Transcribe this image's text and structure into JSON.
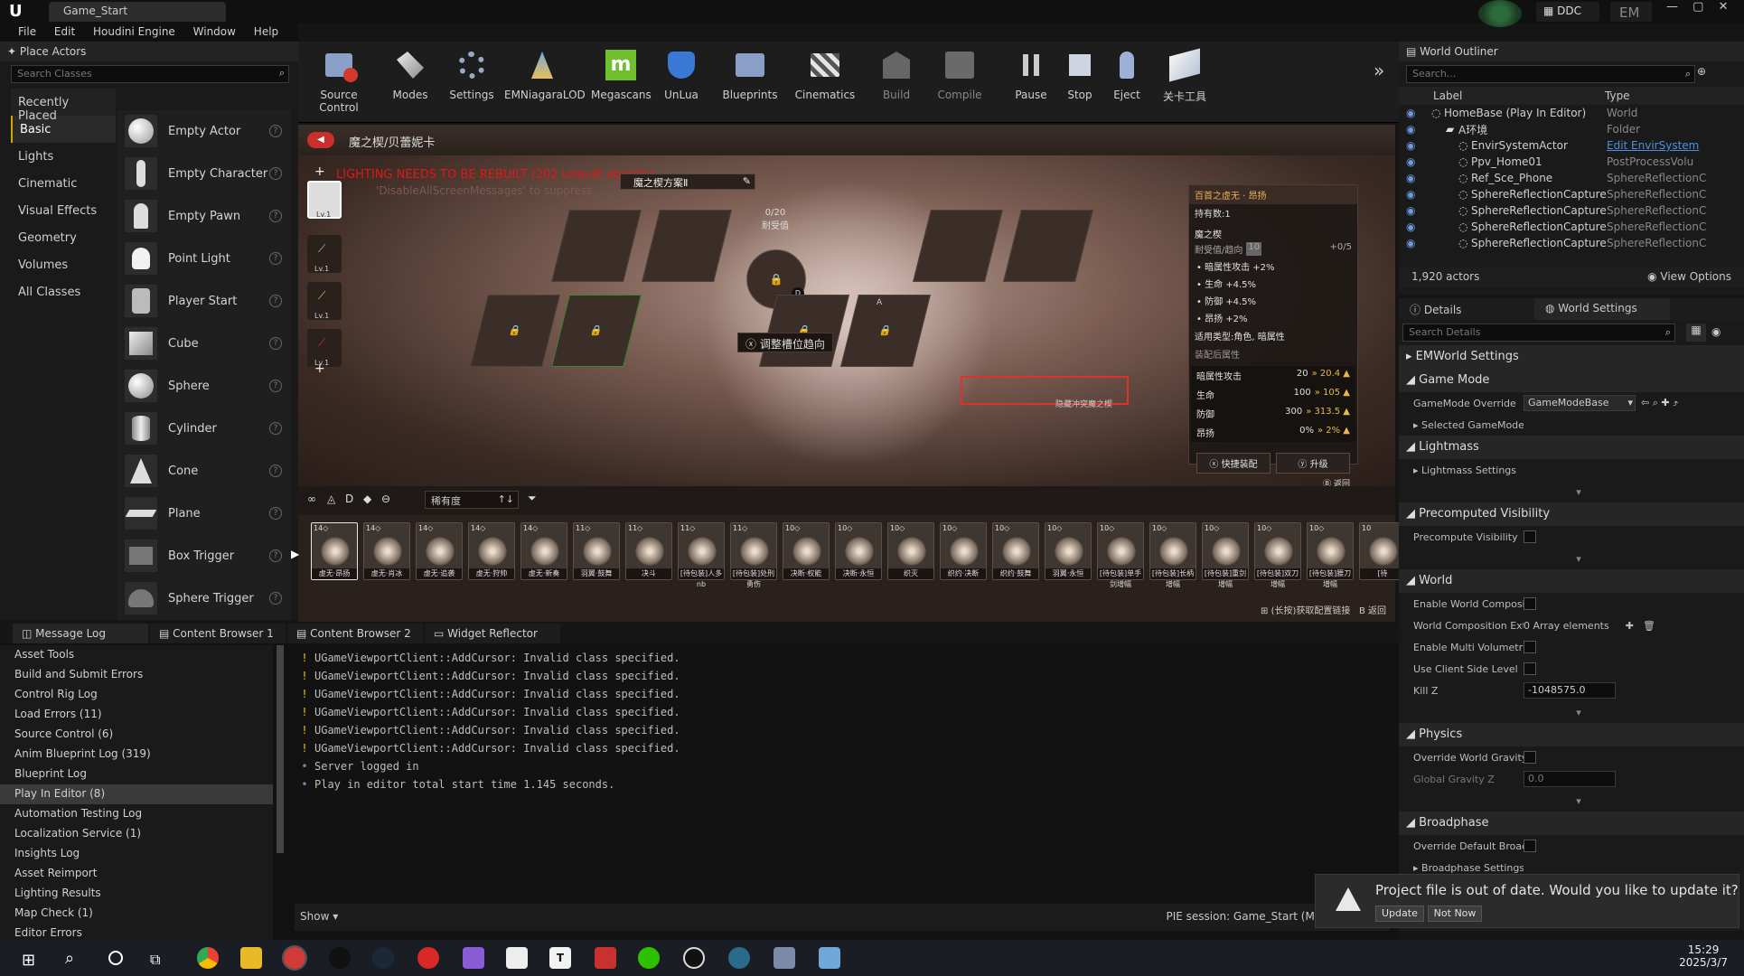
{
  "app": {
    "tab_title": "Game_Start",
    "menu": [
      "File",
      "Edit",
      "Houdini Engine",
      "Window",
      "Help"
    ],
    "ddc_label": "DDC",
    "user_initials": "EM"
  },
  "place_actors": {
    "title": "Place Actors",
    "search_placeholder": "Search Classes",
    "categories": [
      "Recently Placed",
      "Basic",
      "Lights",
      "Cinematic",
      "Visual Effects",
      "Geometry",
      "Volumes",
      "All Classes"
    ],
    "active_category": "Basic",
    "actors": [
      "Empty Actor",
      "Empty Character",
      "Empty Pawn",
      "Point Light",
      "Player Start",
      "Cube",
      "Sphere",
      "Cylinder",
      "Cone",
      "Plane",
      "Box Trigger",
      "Sphere Trigger"
    ]
  },
  "toolbar": {
    "tools": [
      "Source Control",
      "Modes",
      "Settings",
      "EMNiagaraLOD",
      "Megascans",
      "UnLua",
      "Blueprints",
      "Cinematics",
      "Build",
      "Compile",
      "Pause",
      "Stop",
      "Eject",
      "关卡工具"
    ]
  },
  "viewport": {
    "header_title": "魔之楔/贝蕾妮卡",
    "lighting_warning": "LIGHTING NEEDS TO BE REBUILT (202 unbuilt objects)",
    "suppress_hint": "'DisableAllScreenMessages' to suppress",
    "plan_label": "魔之楔方案Ⅱ",
    "gauge_value": "0/20",
    "gauge_label": "耐受值",
    "adjust_label": "调整槽位趋向",
    "center_badge": "D",
    "slot_badge": "A",
    "side_icon_level": "Lv.1",
    "stat_panel": {
      "title": "百首之虚无 · 昂扬",
      "owned": "持有数:1",
      "section": "魔之楔",
      "tolerance_label": "耐受值/趋向",
      "tolerance_badge": "10",
      "tolerance_value": "+0/5",
      "effects": [
        "暗属性攻击 +2%",
        "生命 +4.5%",
        "防御 +4.5%",
        "昂扬 +2%"
      ],
      "applicable": "适用类型:角色, 暗属性",
      "after_label": "装配后属性",
      "stats": [
        {
          "name": "暗属性攻击",
          "from": "20",
          "to": "20.4"
        },
        {
          "name": "生命",
          "from": "100",
          "to": "105"
        },
        {
          "name": "防御",
          "from": "300",
          "to": "313.5"
        },
        {
          "name": "昂扬",
          "from": "0%",
          "to": "2%"
        }
      ],
      "btn_quick": "快捷装配",
      "btn_quick_key": "X",
      "btn_upgrade": "升级",
      "btn_upgrade_key": "Y",
      "back_label": "返回",
      "back_key": "B",
      "hide_conflict": "隐藏冲突魔之楔"
    },
    "filter_label": "稀有度",
    "filter_badge": "↑↓",
    "filter_icons": [
      "∞",
      "◬",
      "D",
      "◆",
      "⊖"
    ],
    "cards": [
      "虚无·昂扬",
      "虚无·肖冰",
      "虚无·追袭",
      "虚无·狩帅",
      "虚无·新奏",
      "羽翼·鼓舞",
      "决斗",
      "[待包装]人多nb",
      "[待包装]处刑勇伤",
      "决断·权能",
      "决断·永恒",
      "织灭",
      "织约·决断",
      "织约·鼓舞",
      "羽翼·永恒",
      "[待包装]单手剑增幅",
      "[待包装]长柄增幅",
      "[待包装]重剑增幅",
      "[待包装]双刀增幅",
      "[待包装]腰刀增幅",
      "[待"
    ],
    "card_levels": [
      "14◇",
      "14◇",
      "14◇",
      "14◇",
      "14◇",
      "11◇",
      "11◇",
      "11◇",
      "11◇",
      "10◇",
      "10◇",
      "10◇",
      "10◇",
      "10◇",
      "10◇",
      "10◇",
      "10◇",
      "10◇",
      "10◇",
      "10◇",
      "10"
    ],
    "bottom_hint": "(长按)获取配置链接",
    "bottom_hint_key": "⊞",
    "bottom_back": "返回",
    "bottom_back_key": "B"
  },
  "outliner": {
    "title": "World Outliner",
    "search_placeholder": "Search...",
    "col_label": "Label",
    "col_type": "Type",
    "rows": [
      {
        "label": "HomeBase (Play In Editor)",
        "type": "World"
      },
      {
        "label": "A环境",
        "type": "Folder"
      },
      {
        "label": "EnvirSystemActor",
        "type": "Edit EnvirSystem"
      },
      {
        "label": "Ppv_Home01",
        "type": "PostProcessVolu"
      },
      {
        "label": "Ref_Sce_Phone",
        "type": "SphereReflectionC"
      },
      {
        "label": "SphereReflectionCapture2",
        "type": "SphereReflectionC"
      },
      {
        "label": "SphereReflectionCapture3",
        "type": "SphereReflectionC"
      },
      {
        "label": "SphereReflectionCapture4",
        "type": "SphereReflectionC"
      },
      {
        "label": "SphereReflectionCapture5",
        "type": "SphereReflectionC"
      }
    ],
    "actor_count": "1,920 actors",
    "view_options": "View Options"
  },
  "details": {
    "tab_details": "Details",
    "tab_world_settings": "World Settings",
    "search_placeholder": "Search Details",
    "sections": {
      "emworld": "EMWorld Settings",
      "gamemode": "Game Mode",
      "gamemode_override_label": "GameMode Override",
      "gamemode_override_value": "GameModeBase",
      "selected_gamemode": "Selected GameMode",
      "lightmass": "Lightmass",
      "lightmass_settings": "Lightmass Settings",
      "precomputed": "Precomputed Visibility",
      "precompute_visibility": "Precompute Visibility",
      "world": "World",
      "enable_world_comp": "Enable World Composi",
      "world_comp_ext": "World Composition Ext",
      "world_comp_ext_value": "0 Array elements",
      "enable_multi_vol": "Enable Multi Volumetr",
      "use_client_side": "Use Client Side Level",
      "kill_z": "Kill Z",
      "kill_z_value": "-1048575.0",
      "physics": "Physics",
      "override_gravity": "Override World Gravity",
      "global_gravity": "Global Gravity Z",
      "global_gravity_value": "0.0",
      "broadphase": "Broadphase",
      "override_broad": "Override Default Broac",
      "broad_settings": "Broadphase Settings"
    }
  },
  "bottom": {
    "tabs": [
      "Message Log",
      "Content Browser 1",
      "Content Browser 2",
      "Widget Reflector"
    ],
    "log_categories": [
      "Asset Tools",
      "Build and Submit Errors",
      "Control Rig Log",
      "Load Errors (11)",
      "Source Control (6)",
      "Anim Blueprint Log (319)",
      "Blueprint Log",
      "Play In Editor (8)",
      "Automation Testing Log",
      "Localization Service (1)",
      "Insights Log",
      "Asset Reimport",
      "Lighting Results",
      "Map Check (1)",
      "Editor Errors"
    ],
    "selected_category": "Play In Editor (8)",
    "lines": [
      {
        "kind": "warn",
        "text": "UGameViewportClient::AddCursor: Invalid class specified."
      },
      {
        "kind": "warn",
        "text": "UGameViewportClient::AddCursor: Invalid class specified."
      },
      {
        "kind": "warn",
        "text": "UGameViewportClient::AddCursor: Invalid class specified."
      },
      {
        "kind": "warn",
        "text": "UGameViewportClient::AddCursor: Invalid class specified."
      },
      {
        "kind": "warn",
        "text": "UGameViewportClient::AddCursor: Invalid class specified."
      },
      {
        "kind": "warn",
        "text": "UGameViewportClient::AddCursor: Invalid class specified."
      },
      {
        "kind": "info",
        "text": "Server logged in"
      },
      {
        "kind": "info",
        "text": "Play in editor total start time 1.145 seconds."
      }
    ],
    "show_label": "Show",
    "pie_session": "PIE session: Game_Start (Mar 7, 2025, 1"
  },
  "notification": {
    "text": "Project file is out of date. Would you like to update it?",
    "update": "Update",
    "not_now": "Not Now"
  },
  "taskbar": {
    "time": "15:29",
    "date": "2025/3/7"
  },
  "colors": {
    "accent": "#d6a400",
    "red_warning": "#e01818",
    "panel": "#1a1a1a"
  }
}
